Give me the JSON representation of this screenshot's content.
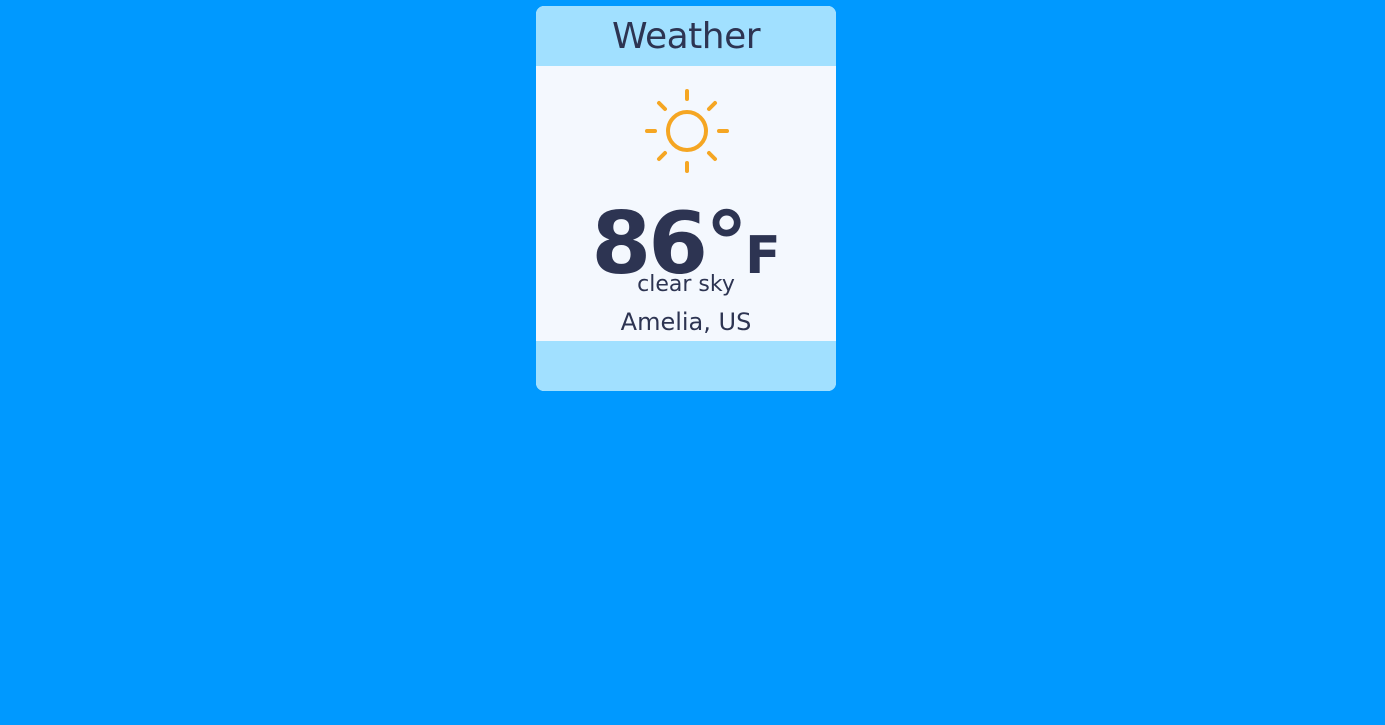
{
  "page": {
    "background_color": "#0099ff"
  },
  "widget": {
    "title": "Weather",
    "icon": "sun-icon",
    "icon_color": "#f5a623",
    "temperature": "86°",
    "unit": "F",
    "condition": "clear sky",
    "location": "Amelia, US",
    "header_color": "#a1e0ff",
    "text_color": "#2d3452"
  }
}
